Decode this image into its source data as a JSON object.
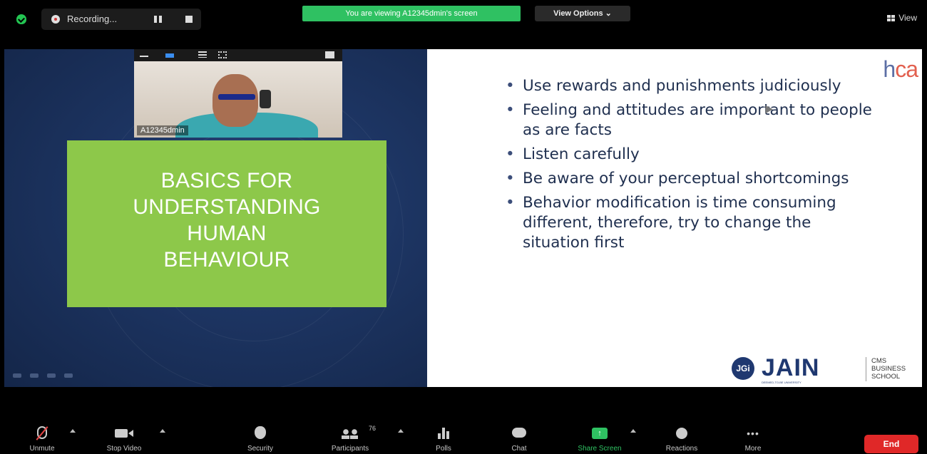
{
  "topbar": {
    "recording_label": "Recording...",
    "viewing_banner": "You are viewing A12345dmin's screen",
    "view_options_label": "View Options ⌄",
    "view_label": "View"
  },
  "video": {
    "participant_name": "A12345dmin"
  },
  "slide": {
    "title_lines": [
      "BASICS FOR",
      "UNDERSTANDING",
      "HUMAN",
      "BEHAVIOUR"
    ],
    "bullets": [
      "Use rewards and punishments judiciously",
      "Feeling and attitudes are important to people as are facts",
      "Listen carefully",
      "Be aware of your perceptual shortcomings",
      "Behavior modification is time consuming different, therefore, try to change the situation first"
    ],
    "hca_logo": {
      "h": "h",
      "ca": "ca"
    },
    "jgi_mark": "JGi",
    "jain_word": "JAIN",
    "jain_sub": "DEEMED-TO-BE UNIVERSITY",
    "cms_lines": [
      "CMS",
      "BUSINESS",
      "SCHOOL"
    ]
  },
  "toolbar": {
    "unmute": "Unmute",
    "stop_video": "Stop Video",
    "security": "Security",
    "participants": "Participants",
    "participant_count": "76",
    "polls": "Polls",
    "chat": "Chat",
    "share_screen": "Share Screen",
    "reactions": "Reactions",
    "more": "More",
    "end": "End"
  },
  "colors": {
    "share_green": "#2fc162",
    "slide_green": "#8dc84a",
    "slide_navy": "#1d3563",
    "end_red": "#e02828"
  }
}
